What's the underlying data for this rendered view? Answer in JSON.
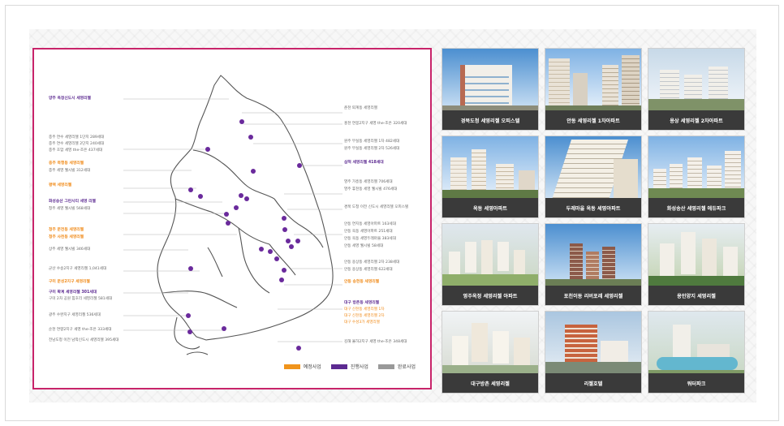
{
  "map": {
    "labels_left": [
      {
        "text": "양주 옥정신도시 세영리첼",
        "cls": "bold c-purple"
      },
      {
        "text": "충주 연수 세영리첼 1단지 289세대",
        "cls": "c-gray"
      },
      {
        "text": "충주 연수 세영리첼 2단지 240세대",
        "cls": "c-gray"
      },
      {
        "text": "충주 호암 세영 the-조은 437세대",
        "cls": "c-gray"
      },
      {
        "text": "충주 목행동 세영리첼",
        "cls": "bold c-orange"
      },
      {
        "text": "충주 세영 웰시빌 312세대",
        "cls": "c-gray"
      },
      {
        "text": "평택 세영리첼",
        "cls": "bold c-orange"
      },
      {
        "text": "화성송산 그린시티 세영 리첼",
        "cls": "bold c-purple"
      },
      {
        "text": "청주 세영 웰시빌 568세대",
        "cls": "c-gray"
      },
      {
        "text": "청주 문전동 세영리첼",
        "cls": "bold c-orange"
      },
      {
        "text": "청주 사천동 세영리첼",
        "cls": "bold c-orange"
      },
      {
        "text": "상주 세영 웰시빌 346세대",
        "cls": "c-gray"
      },
      {
        "text": "군산 수송2지구 세영리첼 1,041세대",
        "cls": "c-gray"
      },
      {
        "text": "구미 문성2지구 세영리첼",
        "cls": "bold c-orange"
      },
      {
        "text": "구미 확계 세영리첼 301세대",
        "cls": "bold c-purple"
      },
      {
        "text": "구미 2차 공원 힘호리 세영리첼 581세대",
        "cls": "c-gray"
      },
      {
        "text": "광주 수완지구 세영리첼 536세대",
        "cls": "c-gray"
      },
      {
        "text": "순천 연향2지구 세영 the-조은 333세대",
        "cls": "c-gray"
      },
      {
        "text": "전남도청 이전 남악신도시 세영리첼 395세대",
        "cls": "c-gray"
      }
    ],
    "labels_right": [
      {
        "text": "춘천 퇴계동 세영리첼",
        "cls": "c-gray"
      },
      {
        "text": "홍천 연봉2지구 세영 the-조은 320세대",
        "cls": "c-gray"
      },
      {
        "text": "원주 무실동 세영리첼 1차 482세대",
        "cls": "c-gray"
      },
      {
        "text": "원주 무실동 세영리첼 2차 526세대",
        "cls": "c-gray"
      },
      {
        "text": "삼척 세영리첼 418세대",
        "cls": "bold c-purple"
      },
      {
        "text": "영주 가흥동 세영리첼 706세대",
        "cls": "c-gray"
      },
      {
        "text": "영주 휴천동 세영 웰시빌 476세대",
        "cls": "c-gray"
      },
      {
        "text": "경북 도청 이전 신도시 세영리첼 오피스텔",
        "cls": "c-gray"
      },
      {
        "text": "안동 연지동 세영아파트 163세대",
        "cls": "c-gray"
      },
      {
        "text": "안동 옥동 세영아파트 251세대",
        "cls": "c-gray"
      },
      {
        "text": "안동 옥동 세영두레마을 383세대",
        "cls": "c-gray"
      },
      {
        "text": "안동 세영 웰시빌 58세대",
        "cls": "c-gray"
      },
      {
        "text": "안동 용상동 세영리첼 2차 238세대",
        "cls": "c-gray"
      },
      {
        "text": "안동 용상동 세영리첼 622세대",
        "cls": "c-gray"
      },
      {
        "text": "안동 송현동 세영리첼",
        "cls": "bold c-orange"
      },
      {
        "text": "대구 방촌동 세영리첼",
        "cls": "bold c-purple"
      },
      {
        "text": "대구 신천동 세영리첼 1차",
        "cls": "c-orange"
      },
      {
        "text": "대구 신천동 세영리첼 2차",
        "cls": "c-orange"
      },
      {
        "text": "대구 수성3가 세영리첼",
        "cls": "c-orange"
      },
      {
        "text": "김해 율하2지구 세영 the-조은 348세대",
        "cls": "c-gray"
      }
    ],
    "legend": [
      {
        "label": "예정사업",
        "color": "#f0941c"
      },
      {
        "label": "진행사업",
        "color": "#5c2a91"
      },
      {
        "label": "완료사업",
        "color": "#999999"
      }
    ],
    "colors": {
      "border": "#c8246a",
      "dot": "#6a2a9c",
      "leader": "#b5b5b5",
      "outline": "#555555"
    }
  },
  "photos": [
    {
      "caption": "경북도청 세영리첼 오피스텔"
    },
    {
      "caption": "안동 세영리첼 1차아파트"
    },
    {
      "caption": "용상 세영리첼 2차아파트"
    },
    {
      "caption": "옥동 세영아파트"
    },
    {
      "caption": "두레마을 옥동 세영아파트"
    },
    {
      "caption": "화성송산 세영리첼 에듀파크"
    },
    {
      "caption": "영주옥정 세영리첼 아파트"
    },
    {
      "caption": "포천이동 리버포레 세영리첼"
    },
    {
      "caption": "용인양지 세영리첼"
    },
    {
      "caption": "대구방촌 세영리첼"
    },
    {
      "caption": "리첼호텔"
    },
    {
      "caption": "워터파크"
    }
  ]
}
